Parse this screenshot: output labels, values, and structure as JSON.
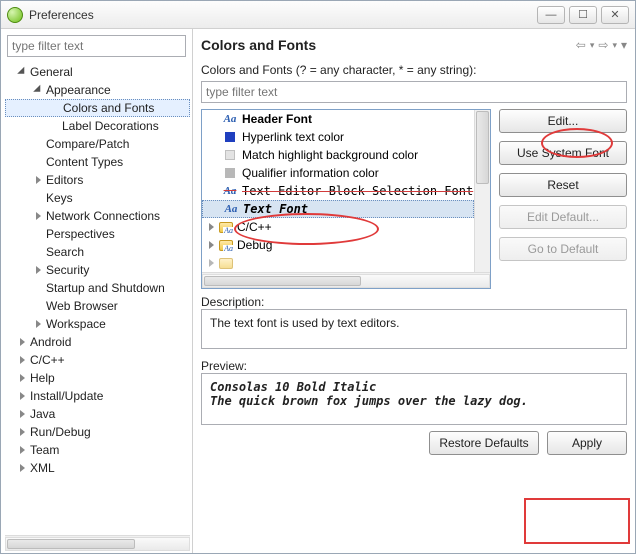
{
  "window": {
    "title": "Preferences"
  },
  "left_filter_placeholder": "type filter text",
  "tree": {
    "n0": {
      "label": "General"
    },
    "n1": {
      "label": "Appearance"
    },
    "n2": {
      "label": "Colors and Fonts"
    },
    "n3": {
      "label": "Label Decorations"
    },
    "n4": {
      "label": "Compare/Patch"
    },
    "n5": {
      "label": "Content Types"
    },
    "n6": {
      "label": "Editors"
    },
    "n7": {
      "label": "Keys"
    },
    "n8": {
      "label": "Network Connections"
    },
    "n9": {
      "label": "Perspectives"
    },
    "n10": {
      "label": "Search"
    },
    "n11": {
      "label": "Security"
    },
    "n12": {
      "label": "Startup and Shutdown"
    },
    "n13": {
      "label": "Web Browser"
    },
    "n14": {
      "label": "Workspace"
    },
    "n15": {
      "label": "Android"
    },
    "n16": {
      "label": "C/C++"
    },
    "n17": {
      "label": "Help"
    },
    "n18": {
      "label": "Install/Update"
    },
    "n19": {
      "label": "Java"
    },
    "n20": {
      "label": "Run/Debug"
    },
    "n21": {
      "label": "Team"
    },
    "n22": {
      "label": "XML"
    }
  },
  "panel": {
    "heading": "Colors and Fonts",
    "subtext": "Colors and Fonts (? = any character, * = any string):",
    "filter_placeholder": "type filter text"
  },
  "list": {
    "i0": {
      "label": "Header Font"
    },
    "i1": {
      "label": "Hyperlink text color"
    },
    "i2": {
      "label": "Match highlight background color"
    },
    "i3": {
      "label": "Qualifier information color"
    },
    "i4": {
      "label": "Text Editor Block Selection Font"
    },
    "i5": {
      "label": "Text Font"
    },
    "f0": {
      "label": "C/C++"
    },
    "f1": {
      "label": "Debug"
    }
  },
  "buttons": {
    "edit": "Edit...",
    "use_system": "Use System Font",
    "reset": "Reset",
    "edit_default": "Edit Default...",
    "goto_default": "Go to Default",
    "restore": "Restore Defaults",
    "apply": "Apply"
  },
  "desc": {
    "label": "Description:",
    "text": "The text font is used by text editors."
  },
  "preview": {
    "label": "Preview:",
    "text": "Consolas 10 Bold Italic\nThe quick brown fox jumps over the lazy dog."
  },
  "icons": {
    "aa": "Aa",
    "back": "⇦",
    "fwd": "⇨",
    "menu": "▾"
  }
}
